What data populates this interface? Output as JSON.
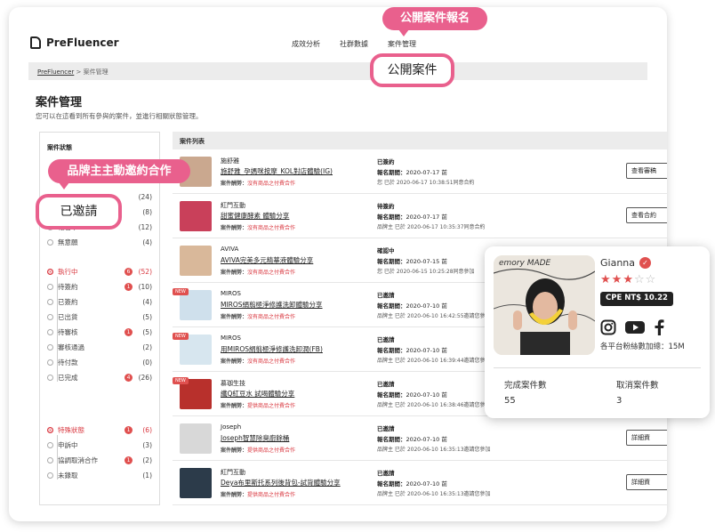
{
  "header": {
    "logo_text": "PreFluencer",
    "nav": [
      "成效分析",
      "社群數據",
      "案件管理"
    ]
  },
  "breadcrumb": {
    "root": "PreFluencer",
    "sep": " > ",
    "current": "案件管理"
  },
  "page": {
    "title": "案件管理",
    "subtitle": "您可以在這看到所有參與的案件，並進行相關狀態管理。"
  },
  "sidebar": {
    "title": "案件狀態",
    "group1": [
      {
        "label": "",
        "count": "(24)"
      },
      {
        "label": "已邀請",
        "count": "(8)"
      },
      {
        "label": "報名中",
        "count": "(12)"
      },
      {
        "label": "無意願",
        "count": "(4)"
      }
    ],
    "group2_head": {
      "label": "執行中",
      "badge": "6",
      "count": "(52)"
    },
    "group2": [
      {
        "label": "待簽約",
        "badge": "1",
        "count": "(10)"
      },
      {
        "label": "已簽約",
        "badge": "",
        "count": "(4)"
      },
      {
        "label": "已出貨",
        "badge": "",
        "count": "(5)"
      },
      {
        "label": "待審核",
        "badge": "1",
        "count": "(5)"
      },
      {
        "label": "審核通過",
        "badge": "",
        "count": "(2)"
      },
      {
        "label": "待付款",
        "badge": "",
        "count": "(0)"
      },
      {
        "label": "已完成",
        "badge": "4",
        "count": "(26)"
      }
    ],
    "group3_head": {
      "label": "特殊狀態",
      "badge": "1",
      "count": "(6)"
    },
    "group3": [
      {
        "label": "申訴中",
        "badge": "",
        "count": "(3)"
      },
      {
        "label": "協調取消合作",
        "badge": "1",
        "count": "(2)"
      },
      {
        "label": "未錄取",
        "badge": "",
        "count": "(1)"
      }
    ]
  },
  "list": {
    "header": "案件列表",
    "fee_label": "案件酬勞：",
    "deadline_label": "報名期間：",
    "rows": [
      {
        "brand": "施舒雅",
        "title": "施舒雅_孕媽咪按摩_KOL對店體驗(IG)",
        "fee": "沒有商品之付費合作",
        "status": "已簽約",
        "deadline": "2020-07-17 前",
        "note": "您 已於 2020-06-17 10:38:51同意合約",
        "button": "查看審稿",
        "isnew": false,
        "color": "#caa88f"
      },
      {
        "brand": "紅門互動",
        "title": "甜蜜健康酵素 體驗分享",
        "fee": "沒有商品之付費合作",
        "status": "待簽約",
        "deadline": "2020-07-17 前",
        "note": "品牌主 已於 2020-06-17 10:35:37同意合約",
        "button": "查看合約",
        "isnew": false,
        "color": "#c9405a"
      },
      {
        "brand": "AVIVA",
        "title": "AVIVA完美多元精華液體驗分享",
        "fee": "沒有商品之付費合作",
        "status": "確認中",
        "deadline": "2020-07-15 前",
        "note": "您 已於 2020-06-15 10:25:28同意參加",
        "button": "",
        "isnew": false,
        "color": "#d9b89a"
      },
      {
        "brand": "MIROS",
        "title": "MIROS絹翦極淨修護洗卸體驗分享",
        "fee": "沒有商品之付費合作",
        "status": "已邀請",
        "deadline": "2020-07-10 前",
        "note": "品牌主 已於 2020-06-10 16:42:55邀請您參加",
        "button": "",
        "isnew": true,
        "color": "#cfe0ec"
      },
      {
        "brand": "MIROS",
        "title": "用MIROS絹翦極淨修護洗卸潤(FB)",
        "fee": "沒有商品之付費合作",
        "status": "已邀請",
        "deadline": "2020-07-10 前",
        "note": "品牌主 已於 2020-06-10 16:39:44邀請您參加",
        "button": "",
        "isnew": true,
        "color": "#d7e6ef"
      },
      {
        "brand": "慕珈生技",
        "title": "纖Q紅豆水 試喝體驗分享",
        "fee": "提供商品之付費合作",
        "status": "已邀請",
        "deadline": "2020-07-10 前",
        "note": "品牌主 已於 2020-06-10 16:38:46邀請您參加",
        "button": "",
        "isnew": true,
        "color": "#b8302c"
      },
      {
        "brand": "Joseph",
        "title": "Joseph智慧除臭廚餘桶",
        "fee": "提供商品之付費合作",
        "status": "已邀請",
        "deadline": "2020-07-10 前",
        "note": "品牌主 已於 2020-06-10 16:35:13邀請您參加",
        "button": "詳細資",
        "isnew": false,
        "color": "#d8d8d8"
      },
      {
        "brand": "紅門互動",
        "title": "Deya布里斯托系列後背包-試背體驗分享",
        "fee": "提供商品之付費合作",
        "status": "已邀請",
        "deadline": "2020-07-10 前",
        "note": "品牌主 已於 2020-06-10 16:35:13邀請您參加",
        "button": "詳細資",
        "isnew": false,
        "color": "#2c3b4a"
      }
    ]
  },
  "callouts": {
    "top_pill": "公開案件報名",
    "top_box": "公開案件",
    "left_pill": "品牌主主動邀約合作",
    "left_box": "已邀請"
  },
  "profile": {
    "name": "Gianna",
    "stars_on": 3,
    "stars_total": 5,
    "cpe": "CPE   NT$ 10.22",
    "total_followers": "各平台粉絲數加總：15M",
    "photo_text": "emory MADE",
    "completed_label": "完成案件數",
    "completed_value": "55",
    "cancelled_label": "取消案件數",
    "cancelled_value": "3"
  },
  "colors": {
    "accent": "#e9608d",
    "alert": "#e0504f"
  }
}
